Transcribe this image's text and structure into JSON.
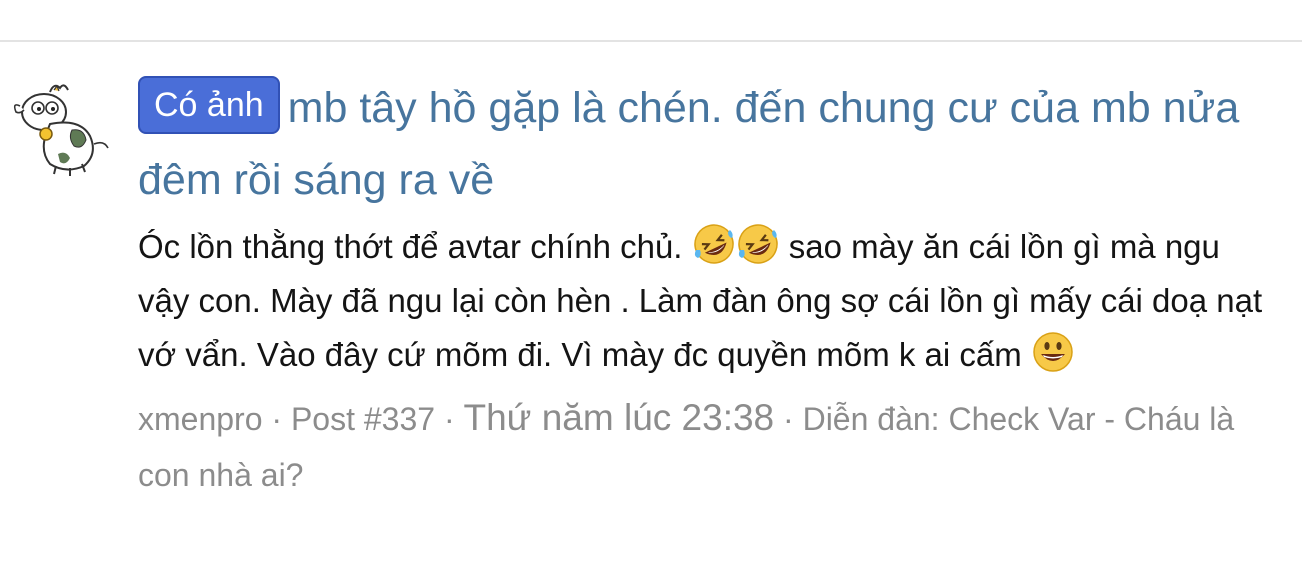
{
  "result": {
    "badge": "Có ảnh",
    "title": "mb tây hồ gặp là chén. đến chung cư của mb nửa đêm rồi sáng ra về",
    "snippet_1": "Óc lồn thằng thớt để avtar chính chủ. ",
    "emoji_1": "rolling-on-floor-laughing-emoji",
    "emoji_2": "rolling-on-floor-laughing-emoji",
    "snippet_2": " sao mày ăn cái lồn gì mà ngu vậy con. Mày đã ngu lại còn hèn . Làm đàn ông sợ cái lồn gì mấy cái doạ nạt vớ vẩn. Vào đây cứ mõm đi. Vì mày đc quyền mõm k ai cấm ",
    "emoji_3": "grinning-face-emoji",
    "meta": {
      "author": "xmenpro",
      "sep": " · ",
      "post": "Post #337",
      "date": "Thứ năm lúc 23:38",
      "forum_label": "Diễn đàn: ",
      "forum": "Check Var - Cháu là con nhà ai?"
    }
  },
  "colors": {
    "title": "#47759e",
    "badge_bg": "#4a6ed8",
    "meta": "#8c8c8c",
    "divider": "#e3e3e3"
  }
}
